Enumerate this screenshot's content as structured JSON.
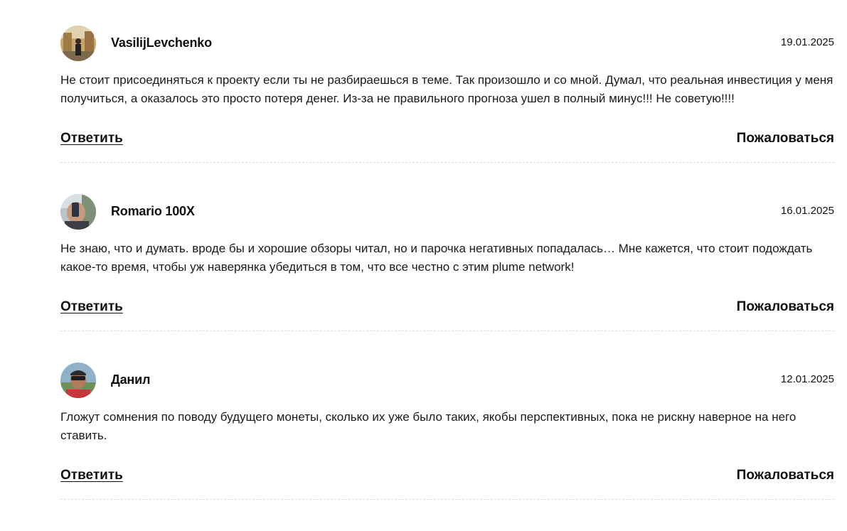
{
  "comments": [
    {
      "author": "VasilijLevchenko",
      "date": "19.01.2025",
      "text": "Не стоит присоединяться к проекту если ты не разбираешься в теме. Так произошло и со мной. Думал, что реальная инвестиция у меня получиться, а оказалось это просто потеря денег. Из-за не правильного прогноза ушел в полный минус!!! Не советую!!!!",
      "reply_label": "Ответить",
      "report_label": "Пожаловаться"
    },
    {
      "author": "Romario 100X",
      "date": "16.01.2025",
      "text": "Не знаю, что и думать. вроде бы и хорошие обзоры читал, но и парочка негативных попадалась… Мне кажется, что стоит подождать какое-то время, чтобы уж наверянка убедиться в том, что все честно с этим plume network!",
      "reply_label": "Ответить",
      "report_label": "Пожаловаться"
    },
    {
      "author": "Данил",
      "date": "12.01.2025",
      "text": "Гложут сомнения по поводу будущего монеты, сколько их уже было таких, якобы перспективных, пока не рискну наверное на него ставить.",
      "reply_label": "Ответить",
      "report_label": "Пожаловаться"
    }
  ]
}
